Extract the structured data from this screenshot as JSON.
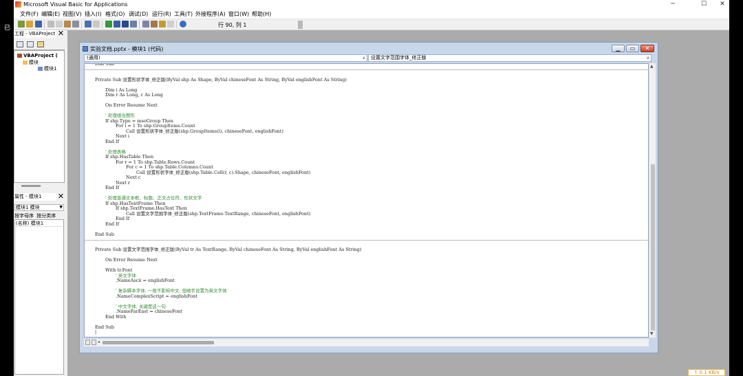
{
  "app": {
    "title": "Microsoft Visual Basic for Applications"
  },
  "window_controls": {
    "minimize": "─",
    "maximize": "☐",
    "close": "✕"
  },
  "overlay": {
    "text": "已"
  },
  "menus": [
    "文件(F)",
    "编辑(E)",
    "视图(V)",
    "插入(I)",
    "格式(O)",
    "调试(D)",
    "运行(R)",
    "工具(T)",
    "外接程序(A)",
    "窗口(W)",
    "帮助(H)"
  ],
  "toolbar": {
    "position": "行 90, 列 1"
  },
  "project_panel": {
    "title": "工程 - VBAProject",
    "close": "✕",
    "tree": {
      "root": "VBAProject (",
      "folder": "模块",
      "module": "模块1"
    }
  },
  "properties_panel": {
    "title": "属性 - 模块1",
    "close": "✕",
    "selected": "模块1 模块",
    "tabs": [
      "按字母序",
      "按分类序"
    ],
    "rows": [
      {
        "name": "(名称)",
        "value": "模块1"
      }
    ]
  },
  "code_window": {
    "title": "实验文档.pptx - 模块1 (代码)",
    "object_combo": "(通用)",
    "procedure_combo": "设置文字范围字体_修正版",
    "lines": [
      {
        "text": "End Sub",
        "indent": 0,
        "kind": "code"
      },
      {
        "text": "",
        "indent": 0,
        "kind": "sep"
      },
      {
        "text": "Private Sub 设置形状字体_修正版(ByVal shp As Shape, ByVal chineseFont As String, ByVal englishFont As String)",
        "indent": 0,
        "kind": "code"
      },
      {
        "text": "",
        "indent": 0,
        "kind": "code"
      },
      {
        "text": "Dim i As Long",
        "indent": 1,
        "kind": "code"
      },
      {
        "text": "Dim r As Long, c As Long",
        "indent": 1,
        "kind": "code"
      },
      {
        "text": "",
        "indent": 0,
        "kind": "code"
      },
      {
        "text": "On Error Resume Next",
        "indent": 1,
        "kind": "code"
      },
      {
        "text": "",
        "indent": 0,
        "kind": "code"
      },
      {
        "text": "' 处理组合图形",
        "indent": 1,
        "kind": "comment"
      },
      {
        "text": "If shp.Type = msoGroup Then",
        "indent": 1,
        "kind": "code"
      },
      {
        "text": "For i = 1 To shp.GroupItems.Count",
        "indent": 2,
        "kind": "code"
      },
      {
        "text": "Call 设置形状字体_修正版(shp.GroupItems(i), chineseFont, englishFont)",
        "indent": 3,
        "kind": "code"
      },
      {
        "text": "Next i",
        "indent": 2,
        "kind": "code"
      },
      {
        "text": "End If",
        "indent": 1,
        "kind": "code"
      },
      {
        "text": "",
        "indent": 0,
        "kind": "code"
      },
      {
        "text": "' 处理表格",
        "indent": 1,
        "kind": "comment"
      },
      {
        "text": "If shp.HasTable Then",
        "indent": 1,
        "kind": "code"
      },
      {
        "text": "For r = 1 To shp.Table.Rows.Count",
        "indent": 2,
        "kind": "code"
      },
      {
        "text": "For c = 1 To shp.Table.Columns.Count",
        "indent": 3,
        "kind": "code"
      },
      {
        "text": "Call 设置形状字体_修正版(shp.Table.Cell(r, c).Shape, chineseFont, englishFont)",
        "indent": 4,
        "kind": "code"
      },
      {
        "text": "Next c",
        "indent": 3,
        "kind": "code"
      },
      {
        "text": "Next r",
        "indent": 2,
        "kind": "code"
      },
      {
        "text": "End If",
        "indent": 1,
        "kind": "code"
      },
      {
        "text": "",
        "indent": 0,
        "kind": "code"
      },
      {
        "text": "' 处理普通文本框、标题、正文占位符、形状文字",
        "indent": 1,
        "kind": "comment"
      },
      {
        "text": "If shp.HasTextFrame Then",
        "indent": 1,
        "kind": "code"
      },
      {
        "text": "If shp.TextFrame.HasText Then",
        "indent": 2,
        "kind": "code"
      },
      {
        "text": "Call 设置文字范围字体_修正版(shp.TextFrame.TextRange, chineseFont, englishFont)",
        "indent": 3,
        "kind": "code"
      },
      {
        "text": "End If",
        "indent": 2,
        "kind": "code"
      },
      {
        "text": "End If",
        "indent": 1,
        "kind": "code"
      },
      {
        "text": "",
        "indent": 0,
        "kind": "code"
      },
      {
        "text": "End Sub",
        "indent": 0,
        "kind": "code"
      },
      {
        "text": "",
        "indent": 0,
        "kind": "sep"
      },
      {
        "text": "Private Sub 设置文字范围字体_修正版(ByVal tr As TextRange, ByVal chineseFont As String, ByVal englishFont As String)",
        "indent": 0,
        "kind": "code"
      },
      {
        "text": "",
        "indent": 0,
        "kind": "code"
      },
      {
        "text": "On Error Resume Next",
        "indent": 1,
        "kind": "code"
      },
      {
        "text": "",
        "indent": 0,
        "kind": "code"
      },
      {
        "text": "With tr.Font",
        "indent": 1,
        "kind": "code"
      },
      {
        "text": "' 英文字体",
        "indent": 2,
        "kind": "comment"
      },
      {
        "text": ".NameAscii = englishFont",
        "indent": 2,
        "kind": "code"
      },
      {
        "text": "",
        "indent": 0,
        "kind": "code"
      },
      {
        "text": "' 复杂脚本字体, 一般不影响中文, 但顺手设置为英文字体",
        "indent": 2,
        "kind": "comment"
      },
      {
        "text": ".NameComplexScript = englishFont",
        "indent": 2,
        "kind": "code"
      },
      {
        "text": "",
        "indent": 0,
        "kind": "code"
      },
      {
        "text": "' 中文字体, 关键是这一句",
        "indent": 2,
        "kind": "comment"
      },
      {
        "text": ".NameFarEast = chineseFont",
        "indent": 2,
        "kind": "code"
      },
      {
        "text": "End With",
        "indent": 1,
        "kind": "code"
      },
      {
        "text": "",
        "indent": 0,
        "kind": "code"
      },
      {
        "text": "End Sub",
        "indent": 0,
        "kind": "code"
      },
      {
        "text": "|",
        "indent": 0,
        "kind": "code"
      }
    ]
  },
  "status": {
    "netspeed": "↑ 0.1 KB/s"
  },
  "colors": {
    "comment": "#2e8b2e",
    "code": "#1a1a1a",
    "mdi_background": "#ababab"
  }
}
